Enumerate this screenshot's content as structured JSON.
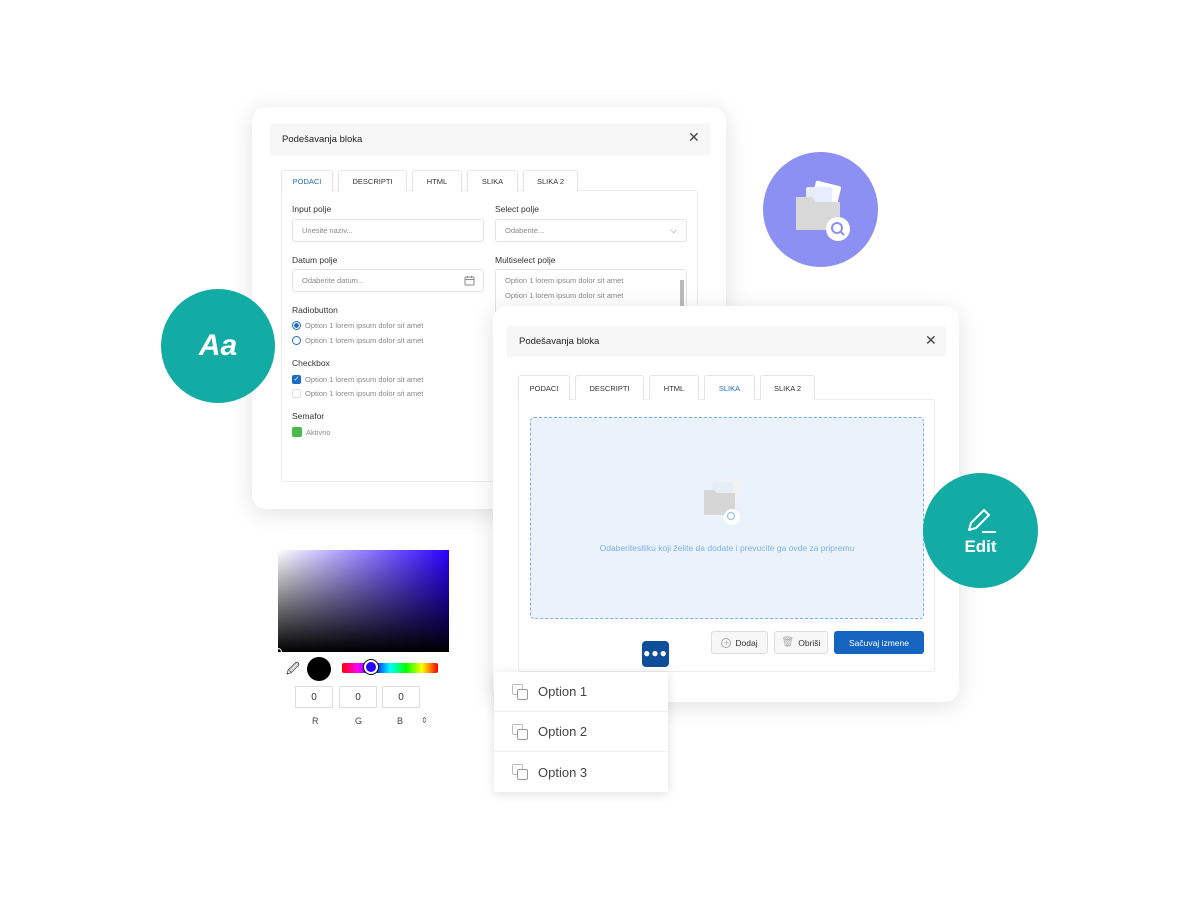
{
  "dialog1": {
    "title": "Podešavanja bloka",
    "tabs": [
      "PODACI",
      "DESCRIPTI",
      "HTML",
      "SLIKA",
      "SLIKA 2"
    ],
    "active_tab": "PODACI",
    "input_label": "Input polje",
    "input_placeholder": "Unesite naziv...",
    "select_label": "Select polje",
    "select_placeholder": "Odaberite...",
    "date_label": "Datum polje",
    "date_placeholder": "Odaberite datum...",
    "multiselect_label": "Multiselect polje",
    "multiselect_options": [
      "Option 1 lorem ipsum dolor sit amet",
      "Option 1 lorem ipsum dolor sit amet"
    ],
    "radio_label": "Radiobutton",
    "radio_options": [
      "Option 1 lorem ipsum dolor sit amet",
      "Option 1 lorem ipsum dolor sit amet"
    ],
    "checkbox_label": "Checkbox",
    "checkbox_options": [
      "Option 1 lorem ipsum dolor sit amet",
      "Option 1 lorem ipsum dolor sit amet"
    ],
    "semafor_label": "Semafor",
    "semafor_value": "Aktivno",
    "semafor_color": "#4cbb4a"
  },
  "dialog2": {
    "title": "Podešavanja bloka",
    "tabs": [
      "PODACI",
      "DESCRIPTI",
      "HTML",
      "SLIKA",
      "SLIKA 2"
    ],
    "active_tab": "SLIKA",
    "dropzone_text": "Odaberiteslliku koji želite da dodate i prevucite ga ovde za pripremu",
    "add_label": "Dodaj",
    "delete_label": "Obriši",
    "save_label": "Sačuvaj izmene"
  },
  "badges": {
    "font": "Aa",
    "edit": "Edit"
  },
  "dropdown": {
    "items": [
      "Option 1",
      "Option 2",
      "Option 3"
    ]
  },
  "color_picker": {
    "r": "0",
    "g": "0",
    "b": "0",
    "labels": [
      "R",
      "G",
      "B"
    ],
    "hue": "#2a00ff",
    "selected": "#000000"
  },
  "colors": {
    "teal": "#13aca5",
    "purple": "#8c90f2",
    "primary": "#1565c0",
    "dots": "#0f4f9a"
  }
}
